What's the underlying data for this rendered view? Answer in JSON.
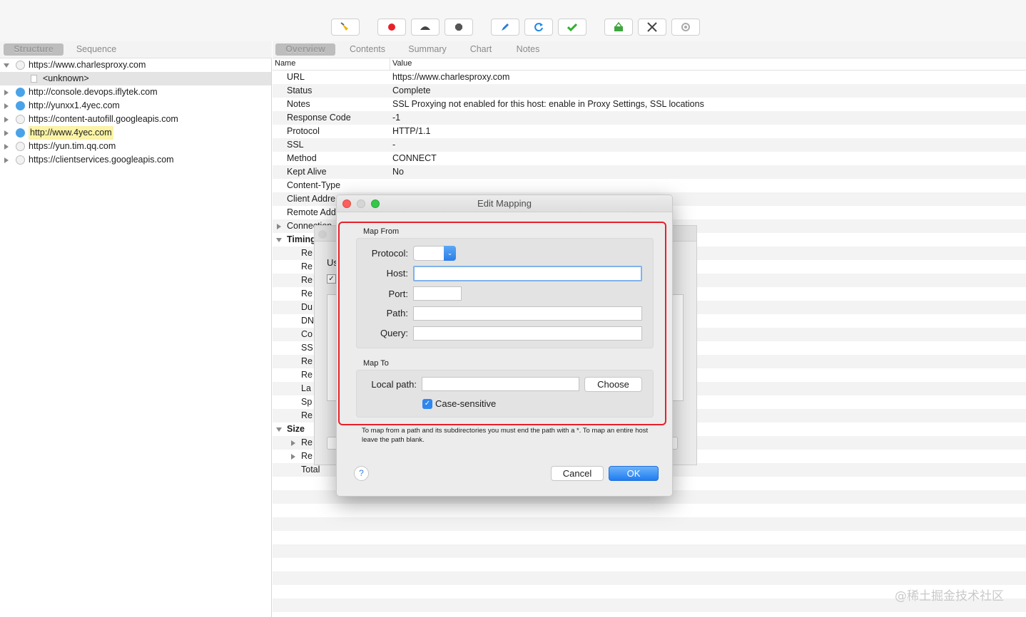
{
  "toolbar": {
    "buttons": [
      "broom-icon",
      "record-icon",
      "throttle-icon",
      "stop-icon",
      "pen-icon",
      "refresh-icon",
      "checkmark-icon",
      "basket-icon",
      "tools-icon",
      "settings-icon"
    ]
  },
  "left_tabs": [
    "Structure",
    "Sequence"
  ],
  "right_tabs": [
    "Overview",
    "Contents",
    "Summary",
    "Chart",
    "Notes"
  ],
  "tree": [
    {
      "label": "https://www.charlesproxy.com",
      "expanded": true,
      "icon": "lock"
    },
    {
      "label": "<unknown>",
      "child": true
    },
    {
      "label": "http://console.devops.iflytek.com",
      "icon": "globe"
    },
    {
      "label": "http://yunxx1.4yec.com",
      "icon": "globe"
    },
    {
      "label": "https://content-autofill.googleapis.com",
      "icon": "lock"
    },
    {
      "label": "http://www.4yec.com",
      "icon": "globe",
      "highlight": true
    },
    {
      "label": "https://yun.tim.qq.com",
      "icon": "lock"
    },
    {
      "label": "https://clientservices.googleapis.com",
      "icon": "lock"
    }
  ],
  "overview": {
    "col_name": "Name",
    "col_value": "Value",
    "rows": [
      {
        "name": "URL",
        "value": "https://www.charlesproxy.com"
      },
      {
        "name": "Status",
        "value": "Complete"
      },
      {
        "name": "Notes",
        "value": "SSL Proxying not enabled for this host: enable in Proxy Settings, SSL locations"
      },
      {
        "name": "Response Code",
        "value": "-1"
      },
      {
        "name": "Protocol",
        "value": "HTTP/1.1"
      },
      {
        "name": "SSL",
        "value": "-"
      },
      {
        "name": "Method",
        "value": "CONNECT"
      },
      {
        "name": "Kept Alive",
        "value": "No"
      },
      {
        "name": "Content-Type",
        "value": ""
      },
      {
        "name": "Client Addre",
        "value": ""
      },
      {
        "name": "Remote Add",
        "value": ""
      },
      {
        "name": "Connection",
        "value": ""
      },
      {
        "name": "Timing",
        "value": ""
      },
      {
        "name": "Re",
        "value": ""
      },
      {
        "name": "Re",
        "value": ""
      },
      {
        "name": "Re",
        "value": ""
      },
      {
        "name": "Re",
        "value": ""
      },
      {
        "name": "Du",
        "value": ""
      },
      {
        "name": "DN",
        "value": ""
      },
      {
        "name": "Co",
        "value": ""
      },
      {
        "name": "SS",
        "value": ""
      },
      {
        "name": "Re",
        "value": ""
      },
      {
        "name": "Re",
        "value": ""
      },
      {
        "name": "La",
        "value": ""
      },
      {
        "name": "Sp",
        "value": ""
      },
      {
        "name": "Re",
        "value": ""
      },
      {
        "name": "Size",
        "value": ""
      },
      {
        "name": "Re",
        "value": ""
      },
      {
        "name": "Re",
        "value": ""
      },
      {
        "name": "Total",
        "value": ""
      }
    ]
  },
  "bg_window": {
    "label": "Us"
  },
  "dialog": {
    "title": "Edit Mapping",
    "map_from": "Map From",
    "protocol_label": "Protocol:",
    "host_label": "Host:",
    "port_label": "Port:",
    "path_label": "Path:",
    "query_label": "Query:",
    "map_to": "Map To",
    "local_path_label": "Local path:",
    "choose": "Choose",
    "case_sensitive": "Case-sensitive",
    "hint": "To map from a path and its subdirectories you must end the path with a *. To map an entire host leave the path blank.",
    "help": "?",
    "cancel": "Cancel",
    "ok": "OK"
  },
  "watermark": "@稀土掘金技术社区"
}
